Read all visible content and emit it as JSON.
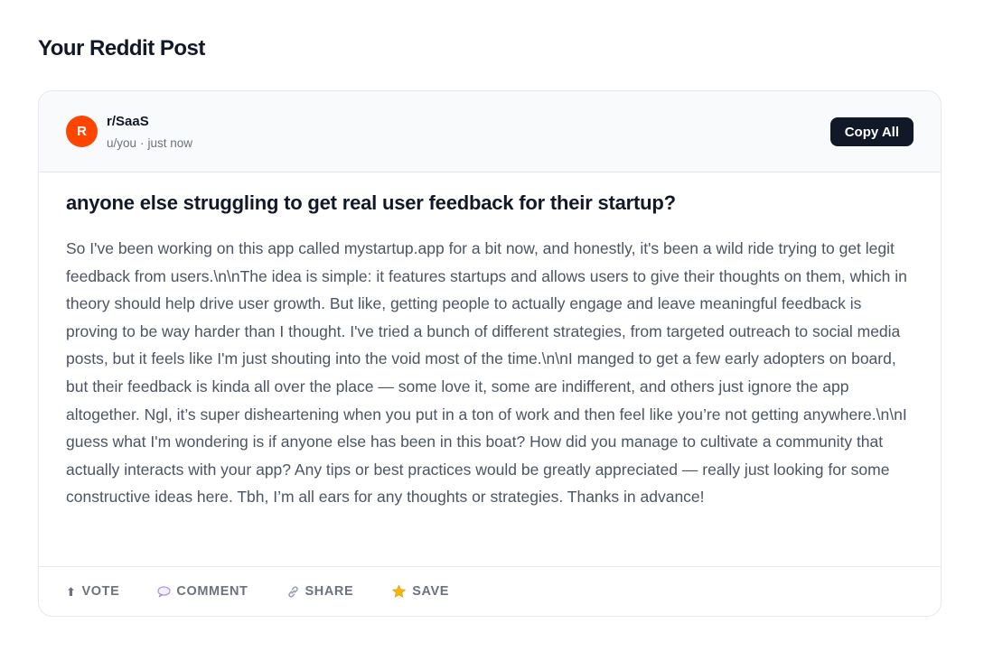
{
  "page": {
    "title": "Your Reddit Post"
  },
  "post": {
    "avatar_letter": "R",
    "subreddit": "r/SaaS",
    "author": "u/you",
    "separator": "·",
    "time": "just now",
    "copy_label": "Copy All",
    "title": "anyone else struggling to get real user feedback for their startup?",
    "body": "So I've been working on this app called mystartup.app for a bit now, and honestly, it's been a wild ride trying to get legit feedback from users.\\n\\nThe idea is simple: it features startups and allows users to give their thoughts on them, which in theory should help drive user growth. But like, getting people to actually engage and leave meaningful feedback is proving to be way harder than I thought. I've tried a bunch of different strategies, from targeted outreach to social media posts, but it feels like I'm just shouting into the void most of the time.\\n\\nI manged to get a few early adopters on board, but their feedback is kinda all over the place — some love it, some are indifferent, and others just ignore the app altogether. Ngl, it’s super disheartening when you put in a ton of work and then feel like you’re not getting anywhere.\\n\\nI guess what I'm wondering is if anyone else has been in this boat? How did you manage to cultivate a community that actually interacts with your app? Any tips or best practices would be greatly appreciated — really just looking for some constructive ideas here. Tbh, I’m all ears for any thoughts or strategies. Thanks in advance!"
  },
  "actions": {
    "vote": {
      "icon": "upvote-arrow-icon",
      "glyph": "⬆",
      "label": "VOTE"
    },
    "comment": {
      "icon": "comment-bubble-icon",
      "label": "COMMENT"
    },
    "share": {
      "icon": "link-icon",
      "label": "SHARE"
    },
    "save": {
      "icon": "star-icon",
      "label": "SAVE"
    }
  },
  "colors": {
    "avatar": "#ff4500",
    "button": "#111827",
    "star": "#f5b50a"
  }
}
